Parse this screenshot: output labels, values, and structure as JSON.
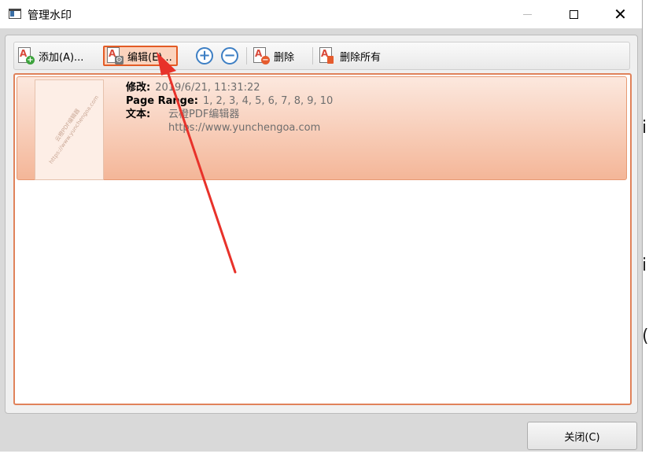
{
  "window": {
    "title": "管理水印"
  },
  "toolbar": {
    "add_label": "添加(A)...",
    "edit_label": "编辑(E)...",
    "increase_symbol": "+",
    "decrease_symbol": "−",
    "delete_label": "删除",
    "delete_all_label": "删除所有"
  },
  "watermarks": [
    {
      "thumbnail_text": "云橙PDF编辑器 https://www.yunchengoa.com",
      "modified_label": "修改:",
      "modified_value": "2019/6/21, 11:31:22",
      "page_range_label": "Page Range:",
      "page_range_value": "1, 2, 3, 4, 5, 6, 7, 8, 9, 10",
      "text_label": "文本:",
      "text_line1": "云橙PDF编辑器",
      "text_line2": "https://www.yunchengoa.com",
      "selected": true
    }
  ],
  "footer": {
    "close_label": "关闭(C)"
  },
  "colors": {
    "selection_border": "#e0825a",
    "annotation_arrow": "#e8322a",
    "active_button_border": "#e35b25"
  }
}
